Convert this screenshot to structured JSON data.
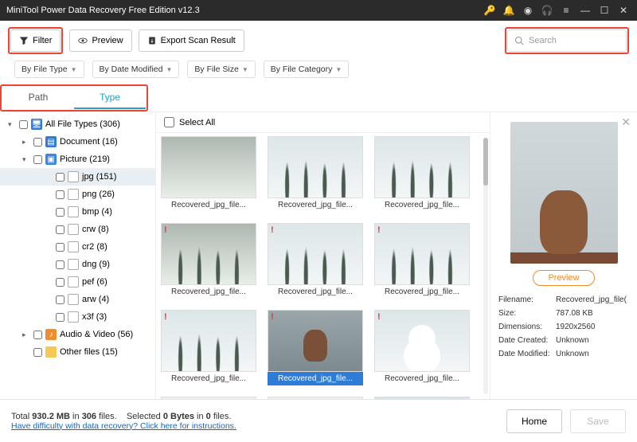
{
  "titlebar": {
    "title": "MiniTool Power Data Recovery Free Edition v12.3"
  },
  "toolbar": {
    "filter": "Filter",
    "preview": "Preview",
    "export": "Export Scan Result",
    "search_placeholder": "Search"
  },
  "filters": {
    "by_type": "By File Type",
    "by_date": "By Date Modified",
    "by_size": "By File Size",
    "by_category": "By File Category"
  },
  "tabs": {
    "path": "Path",
    "type": "Type"
  },
  "tree": {
    "root": "All File Types (306)",
    "document": "Document (16)",
    "picture": "Picture (219)",
    "pic_children": [
      {
        "label": "jpg (151)"
      },
      {
        "label": "png (26)"
      },
      {
        "label": "bmp (4)"
      },
      {
        "label": "crw (8)"
      },
      {
        "label": "cr2 (8)"
      },
      {
        "label": "dng (9)"
      },
      {
        "label": "pef (6)"
      },
      {
        "label": "arw (4)"
      },
      {
        "label": "x3f (3)"
      }
    ],
    "audio": "Audio & Video (56)",
    "other": "Other files (15)"
  },
  "selectall": "Select All",
  "files": [
    {
      "name": "Recovered_jpg_file..."
    },
    {
      "name": "Recovered_jpg_file..."
    },
    {
      "name": "Recovered_jpg_file..."
    },
    {
      "name": "Recovered_jpg_file..."
    },
    {
      "name": "Recovered_jpg_file..."
    },
    {
      "name": "Recovered_jpg_file..."
    },
    {
      "name": "Recovered_jpg_file..."
    },
    {
      "name": "Recovered_jpg_file...",
      "selected": true
    },
    {
      "name": "Recovered_jpg_file..."
    }
  ],
  "preview": {
    "button": "Preview",
    "meta": {
      "filename_k": "Filename:",
      "filename_v": "Recovered_jpg_file(",
      "size_k": "Size:",
      "size_v": "787.08 KB",
      "dim_k": "Dimensions:",
      "dim_v": "1920x2560",
      "created_k": "Date Created:",
      "created_v": "Unknown",
      "modified_k": "Date Modified:",
      "modified_v": "Unknown"
    }
  },
  "status": {
    "total_prefix": "Total ",
    "total_size": "930.2 MB",
    "in": " in ",
    "total_files": "306",
    "files_word": " files.",
    "sel_prefix": "Selected ",
    "sel_size": "0 Bytes",
    "sel_in": " in ",
    "sel_count": "0",
    "sel_files": " files.",
    "help": "Have difficulty with data recovery? Click here for instructions.",
    "home": "Home",
    "save": "Save"
  }
}
